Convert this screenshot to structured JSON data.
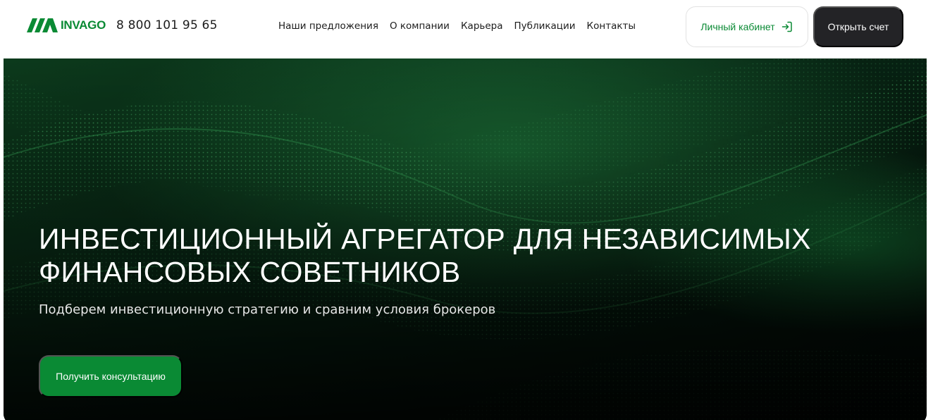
{
  "colors": {
    "brand_green": "#0a8a34",
    "dark_button": "#232326",
    "text_dark": "#1c1c1c",
    "hero_bg": "#04140a"
  },
  "header": {
    "logo_text": "INVAGO",
    "logo_icon": "invago-logo-icon",
    "phone": "8 800 101 95 65",
    "nav": [
      {
        "label": "Наши предложения"
      },
      {
        "label": "О компании"
      },
      {
        "label": "Карьера"
      },
      {
        "label": "Публикации"
      },
      {
        "label": "Контакты"
      }
    ],
    "cabinet_label": "Личный кабинет",
    "cabinet_icon": "login-icon",
    "open_account_label": "Открыть счет"
  },
  "hero": {
    "title_line1": "ИНВЕСТИЦИОННЫЙ АГРЕГАТОР ДЛЯ НЕЗАВИСИМЫХ",
    "title_line2": "ФИНАНСОВЫХ СОВЕТНИКОВ",
    "subtitle": "Подберем инвестиционную стратегию и сравним условия брокеров",
    "cta_label": "Получить консультацию",
    "background": "green-particle-wave-image"
  }
}
